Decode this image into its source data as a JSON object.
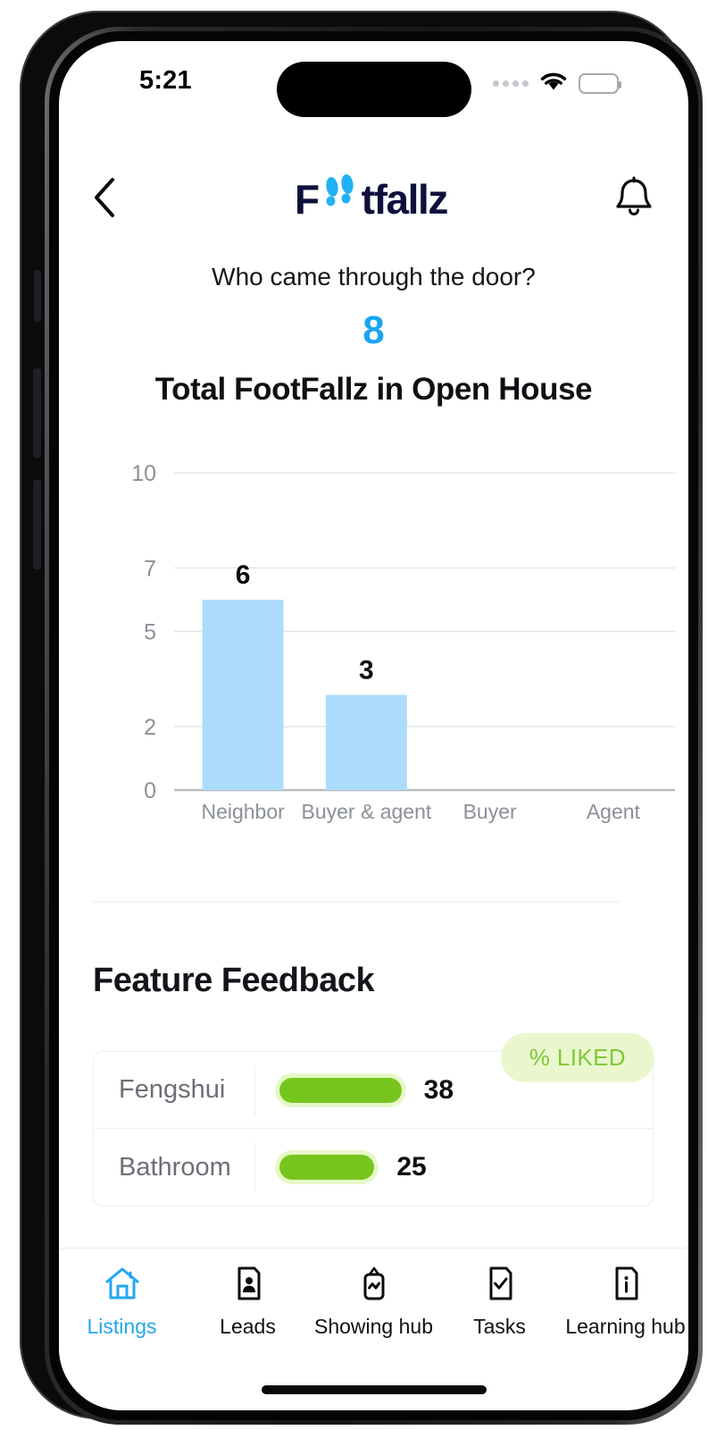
{
  "status_bar": {
    "time": "5:21",
    "cellular_icon": "cellular-dots-icon",
    "wifi_icon": "wifi-icon",
    "battery_icon": "battery-icon"
  },
  "header": {
    "back_icon": "chevron-left-icon",
    "bell_icon": "bell-icon",
    "logo": {
      "part1": "F",
      "footprints_icon": "footprints-icon",
      "part2": "tfallz",
      "color": "#0f0f3d",
      "accent": "#20B2F5"
    }
  },
  "summary": {
    "question": "Who came through the door?",
    "count": "8",
    "count_color": "#19A5F2",
    "caption": "Total FootFallz in Open House"
  },
  "chart_data": {
    "type": "bar",
    "title": "Total FootFallz in Open House",
    "subtitle": "Who came through the door?",
    "categories": [
      "Neighbor",
      "Buyer & agent",
      "Buyer",
      "Agent"
    ],
    "values": [
      6,
      3,
      0,
      0
    ],
    "value_labels": [
      "6",
      "3",
      "",
      ""
    ],
    "xlabel": "",
    "ylabel": "",
    "yticks": [
      0,
      2,
      5,
      7,
      10
    ],
    "ytick_labels": [
      "0",
      "2",
      "5",
      "7",
      "10"
    ],
    "ylim": [
      0,
      10
    ],
    "grid": true,
    "legend": false,
    "bar_color": "#ACDCFC",
    "gridline_color": "#e3e5e8",
    "axis_label_color": "#8b9097",
    "total": 8
  },
  "feature_feedback": {
    "title": "Feature Feedback",
    "badge": "% LIKED",
    "badge_bg": "#EAF7CE",
    "badge_color": "#7FC936",
    "bar_track_color": "#E7F8C8",
    "bar_fill_color": "#76C51C",
    "rows": [
      {
        "label": "Fengshui",
        "value": "38",
        "pct": 38
      },
      {
        "label": "Bathroom",
        "value": "25",
        "pct": 25
      }
    ]
  },
  "bottom_nav": {
    "active_color": "#22A7F0",
    "items": [
      {
        "label": "Listings",
        "icon": "home-icon",
        "active": true
      },
      {
        "label": "Leads",
        "icon": "contact-card-icon",
        "active": false
      },
      {
        "label": "Showing hub",
        "icon": "tv-icon",
        "active": false
      },
      {
        "label": "Tasks",
        "icon": "checklist-document-icon",
        "active": false
      },
      {
        "label": "Learning hub",
        "icon": "info-document-icon",
        "active": false
      }
    ]
  }
}
